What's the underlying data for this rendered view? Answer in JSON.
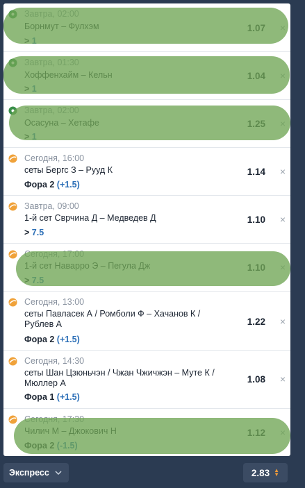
{
  "colors": {
    "tennis_icon": "#f0a23a",
    "football_icon": "#3a8f4a",
    "param": "#2c6fb7",
    "highlight": "#6fa554",
    "footer_bg": "#2b3b52"
  },
  "bets": [
    {
      "sport_icon": "football-icon",
      "time": "Завтра, 02:00",
      "match": "Борнмут – Фулхэм",
      "market": "> ",
      "param": "1",
      "odds": "1.07",
      "close": "×"
    },
    {
      "sport_icon": "football-icon",
      "time": "Завтра, 01:30",
      "match": "Хоффенхайм – Кельн",
      "market": "> ",
      "param": "1",
      "odds": "1.04",
      "close": "×"
    },
    {
      "sport_icon": "football-icon",
      "time": "Завтра, 02:00",
      "match": "Осасуна – Хетафе",
      "market": "> ",
      "param": "1",
      "odds": "1.25",
      "close": "×"
    },
    {
      "sport_icon": "tennis-icon",
      "time": "Сегодня, 16:00",
      "match": "сеты Бергс З – Рууд К",
      "market": "Фора 2 ",
      "param": "(+1.5)",
      "odds": "1.14",
      "close": "×"
    },
    {
      "sport_icon": "tennis-icon",
      "time": "Завтра, 09:00",
      "match": "1-й сет Сврчина Д – Медведев Д",
      "market": "> ",
      "param": "7.5",
      "odds": "1.10",
      "close": "×"
    },
    {
      "sport_icon": "tennis-icon",
      "time": "Сегодня, 17:00",
      "match": "1-й сет Наварро Э – Пегула Дж",
      "market": "> ",
      "param": "7.5",
      "odds": "1.10",
      "close": "×"
    },
    {
      "sport_icon": "tennis-icon",
      "time": "Сегодня, 13:00",
      "match": "сеты Павласек А / Ромболи Ф – Хачанов К / Рублев А",
      "market": "Фора 2 ",
      "param": "(+1.5)",
      "odds": "1.22",
      "close": "×"
    },
    {
      "sport_icon": "tennis-icon",
      "time": "Сегодня, 14:30",
      "match": "сеты Шан Цзюньчэн / Чжан Чжичжэн – Муте К / Мюллер А",
      "market": "Фора 1 ",
      "param": "(+1.5)",
      "odds": "1.08",
      "close": "×"
    },
    {
      "sport_icon": "tennis-icon",
      "time": "Сегодня, 17:30",
      "match": "Чилич М – Джокович Н",
      "market": "Фора 2 ",
      "param": "(-1.5)",
      "odds": "1.12",
      "close": "×"
    }
  ],
  "footer": {
    "express_label": "Экспресс",
    "dropdown_icon": "chevron-down-icon",
    "total_odds": "2.83"
  }
}
